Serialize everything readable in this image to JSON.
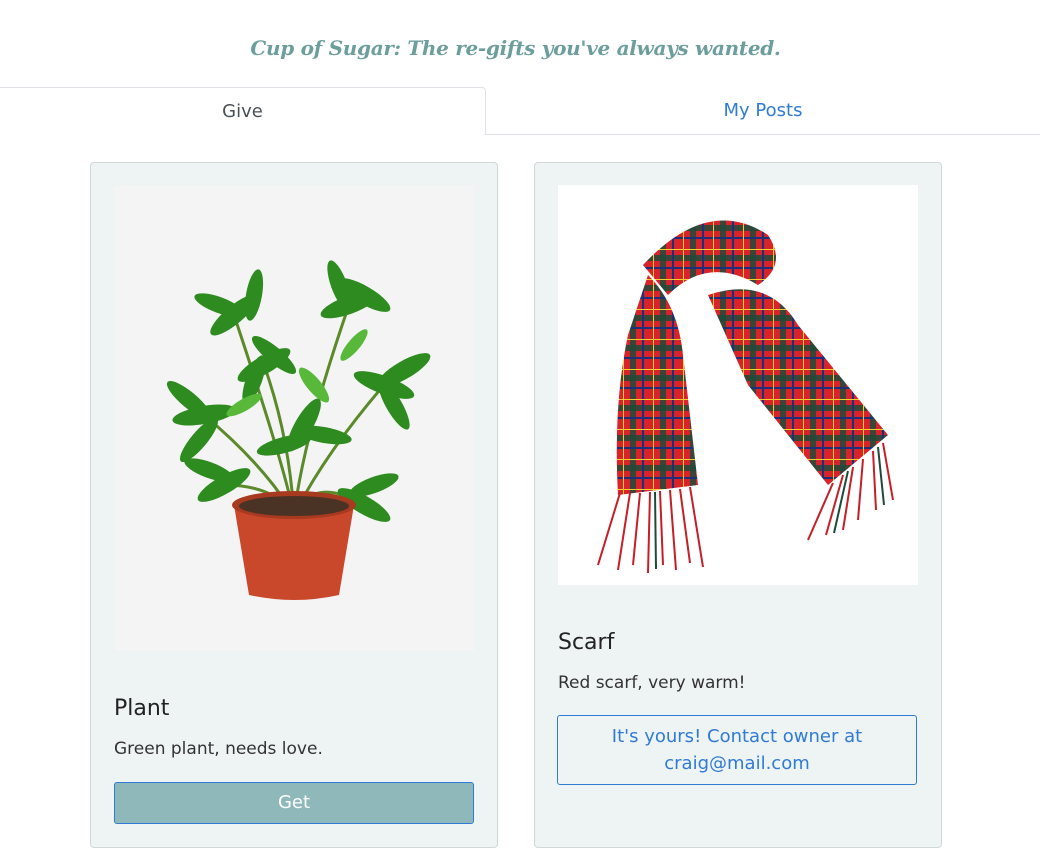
{
  "header": {
    "tagline": "Cup of Sugar: The re-gifts you've always wanted."
  },
  "tabs": [
    {
      "label": "Give",
      "active": true
    },
    {
      "label": "My Posts",
      "active": false
    }
  ],
  "posts": [
    {
      "title": "Plant",
      "description": "Green plant, needs love.",
      "action_label": "Get",
      "image": "potted-plant-photo"
    },
    {
      "title": "Scarf",
      "description": "Red scarf, very warm!",
      "action_label_line1": "It's yours! Contact owner at",
      "action_label_line2": "craig@mail.com",
      "image": "plaid-scarf-photo"
    }
  ],
  "colors": {
    "accent": "#2f7bd6",
    "tagline": "#6b9e9c",
    "card_bg": "#eef3f3",
    "get_button": "#8fb8ba"
  }
}
